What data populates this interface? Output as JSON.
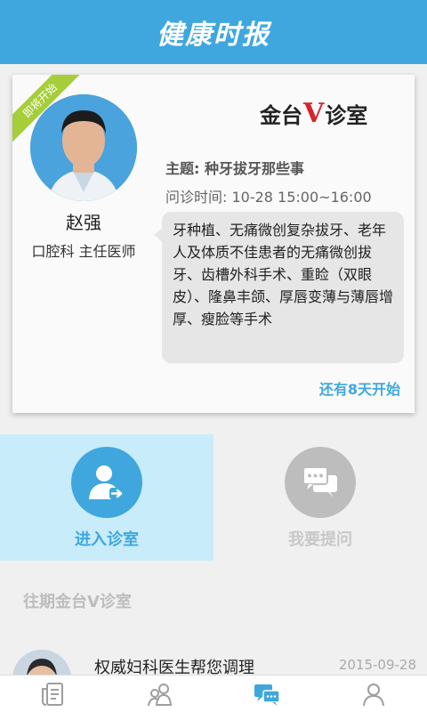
{
  "header": {
    "title": "健康时报"
  },
  "card": {
    "ribbon": "即将开始",
    "doctor": {
      "name": "赵强",
      "title": "口腔科 主任医师"
    },
    "logo": {
      "part1": "金台",
      "v": "V",
      "part2": "诊室"
    },
    "topic": "主题: 种牙拔牙那些事",
    "time": "问诊时间: 10-28 15:00~16:00",
    "description": "牙种植、无痛微创复杂拔牙、老年人及体质不佳患者的无痛微创拔牙、齿槽外科手术、重睑（双眼皮）、隆鼻丰颌、厚唇变薄与薄唇增厚、瘦脸等手术",
    "countdown": "还有8天开始"
  },
  "actions": {
    "enter": {
      "label": "进入诊室",
      "icon": "enter-clinic-icon"
    },
    "ask": {
      "label": "我要提问",
      "icon": "chat-bubbles-icon"
    }
  },
  "past": {
    "section_title": "往期金台V诊室",
    "items": [
      {
        "title": "权威妇科医生帮您调理",
        "date": "2015-09-28"
      }
    ]
  },
  "tabbar": {
    "tabs": [
      {
        "icon": "news-icon",
        "active": false
      },
      {
        "icon": "doctors-icon",
        "active": false
      },
      {
        "icon": "clinic-chat-icon",
        "active": true
      },
      {
        "icon": "profile-icon",
        "active": false
      }
    ]
  },
  "colors": {
    "brand": "#3fa7dd",
    "ribbon": "#a6ce3a",
    "logo_v": "#d6242c",
    "inactive": "#bdbdbd"
  }
}
